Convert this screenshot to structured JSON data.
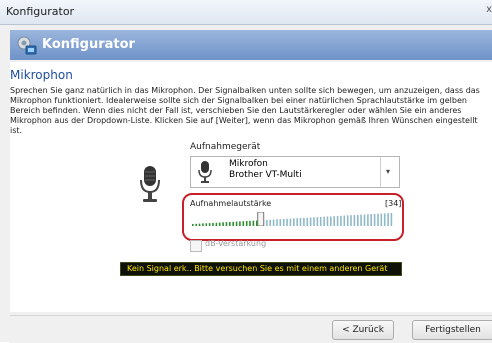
{
  "window": {
    "title": "Konfigurator",
    "close_glyph": "x"
  },
  "header": {
    "title": "Konfigurator",
    "icon": "wizard-icon"
  },
  "section": {
    "heading": "Mikrophon",
    "description": "Sprechen Sie ganz natürlich in das Mikrophon. Der Signalbalken unten sollte sich bewegen, um anzuzeigen, dass das Mikrophon funktioniert. Idealerweise sollte sich der Signalbalken bei einer natürlichen Sprachlautstärke im gelben Bereich befinden. Wenn dies nicht der Fall ist, verschieben Sie den Lautstärkeregler oder wählen Sie ein anderes Mikrophon aus der Dropdown-Liste. Klicken Sie auf [Weiter], wenn das Mikrophon gemäß Ihren Wünschen eingestellt ist."
  },
  "device": {
    "label": "Aufnahmegerät",
    "line1": "Mikrofon",
    "line2": "Brother VT-Multi"
  },
  "volume": {
    "label": "Aufnahmelautstärke",
    "value_text": "[34]",
    "value": 34,
    "max": 100
  },
  "boost": {
    "label": "dB-Verstärkung",
    "checked": false
  },
  "status": {
    "text": "Kein Signal erk.. Bitte versuchen Sie es mit einem anderen Gerät"
  },
  "footer": {
    "back_label": "< Zurück",
    "finish_label": "Fertigstellen"
  },
  "colors": {
    "accent": "#1f4e9c",
    "highlight_frame": "#c8202a",
    "status_text": "#ffe600"
  }
}
